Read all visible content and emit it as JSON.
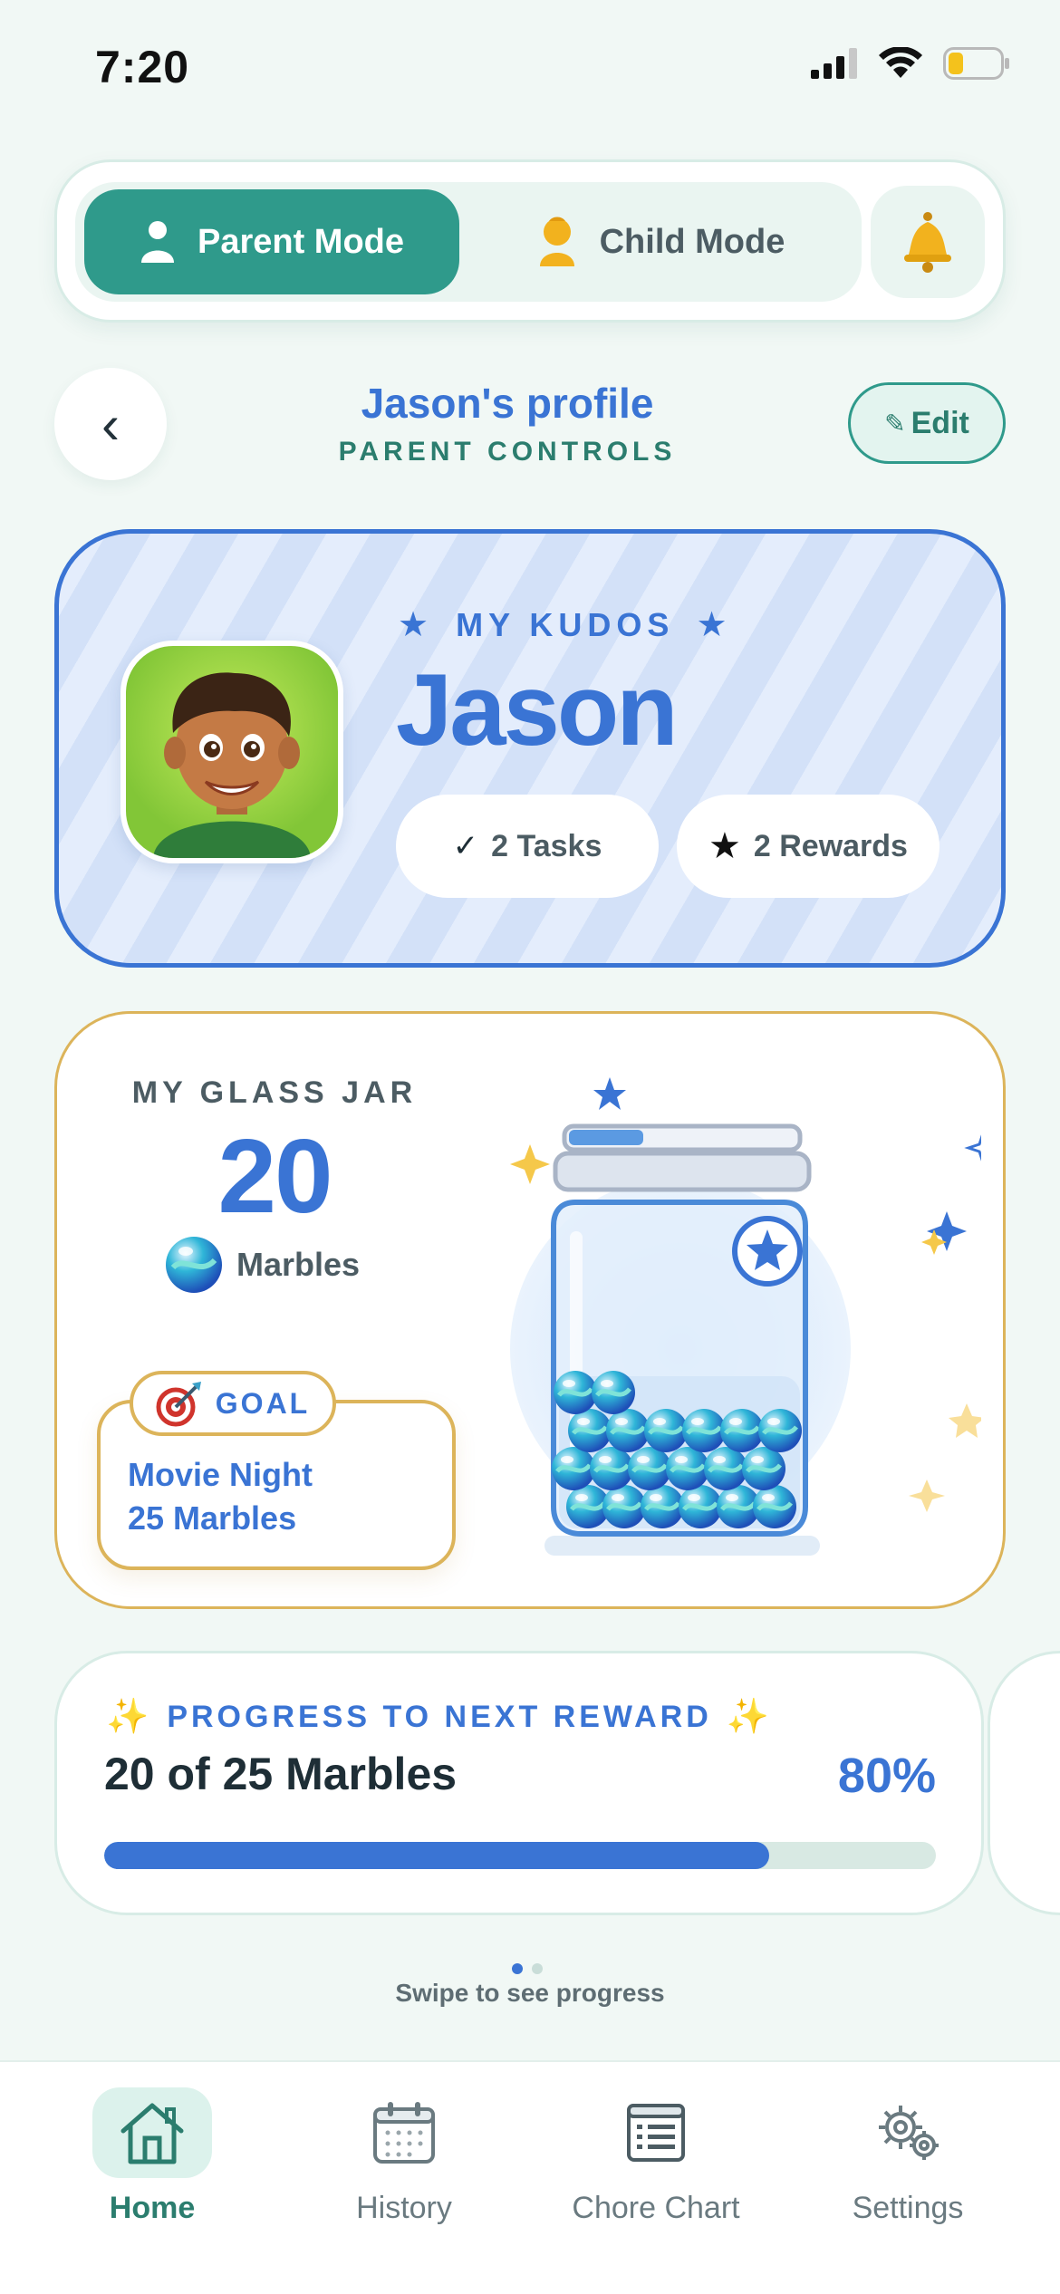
{
  "status": {
    "time": "7:20"
  },
  "mode_switch": {
    "parent_label": "Parent Mode",
    "child_label": "Child Mode",
    "active": "parent"
  },
  "header": {
    "title": "Jason's profile",
    "subtitle": "PARENT CONTROLS",
    "back_glyph": "‹",
    "edit_label": "Edit",
    "edit_glyph": "✎"
  },
  "kudos": {
    "label": "MY KUDOS",
    "name": "Jason",
    "tasks_glyph": "✓",
    "tasks_label": "2 Tasks",
    "rewards_glyph": "★",
    "rewards_label": "2 Rewards"
  },
  "jar": {
    "label": "MY GLASS JAR",
    "count": "20",
    "unit": "Marbles",
    "goal_tag": "GOAL",
    "goal_name": "Movie Night",
    "goal_target": "25 Marbles",
    "lid_progress": 0.33
  },
  "progress": {
    "label": "PROGRESS TO NEXT REWARD",
    "text": "20 of 25 Marbles",
    "percent_label": "80%",
    "fraction": 0.8
  },
  "pager": {
    "hint": "Swipe to see progress",
    "pages": 2,
    "active": 0
  },
  "tabs": [
    {
      "label": "Home",
      "icon": "home-icon",
      "active": true
    },
    {
      "label": "History",
      "icon": "calendar-icon",
      "active": false
    },
    {
      "label": "Chore Chart",
      "icon": "chore-list-icon",
      "active": false
    },
    {
      "label": "Settings",
      "icon": "gear-icon",
      "active": false
    }
  ],
  "colors": {
    "primary_teal": "#2f9a8b",
    "accent_blue": "#3a74d4",
    "gold": "#dcb45a",
    "background": "#f1f8f5"
  }
}
